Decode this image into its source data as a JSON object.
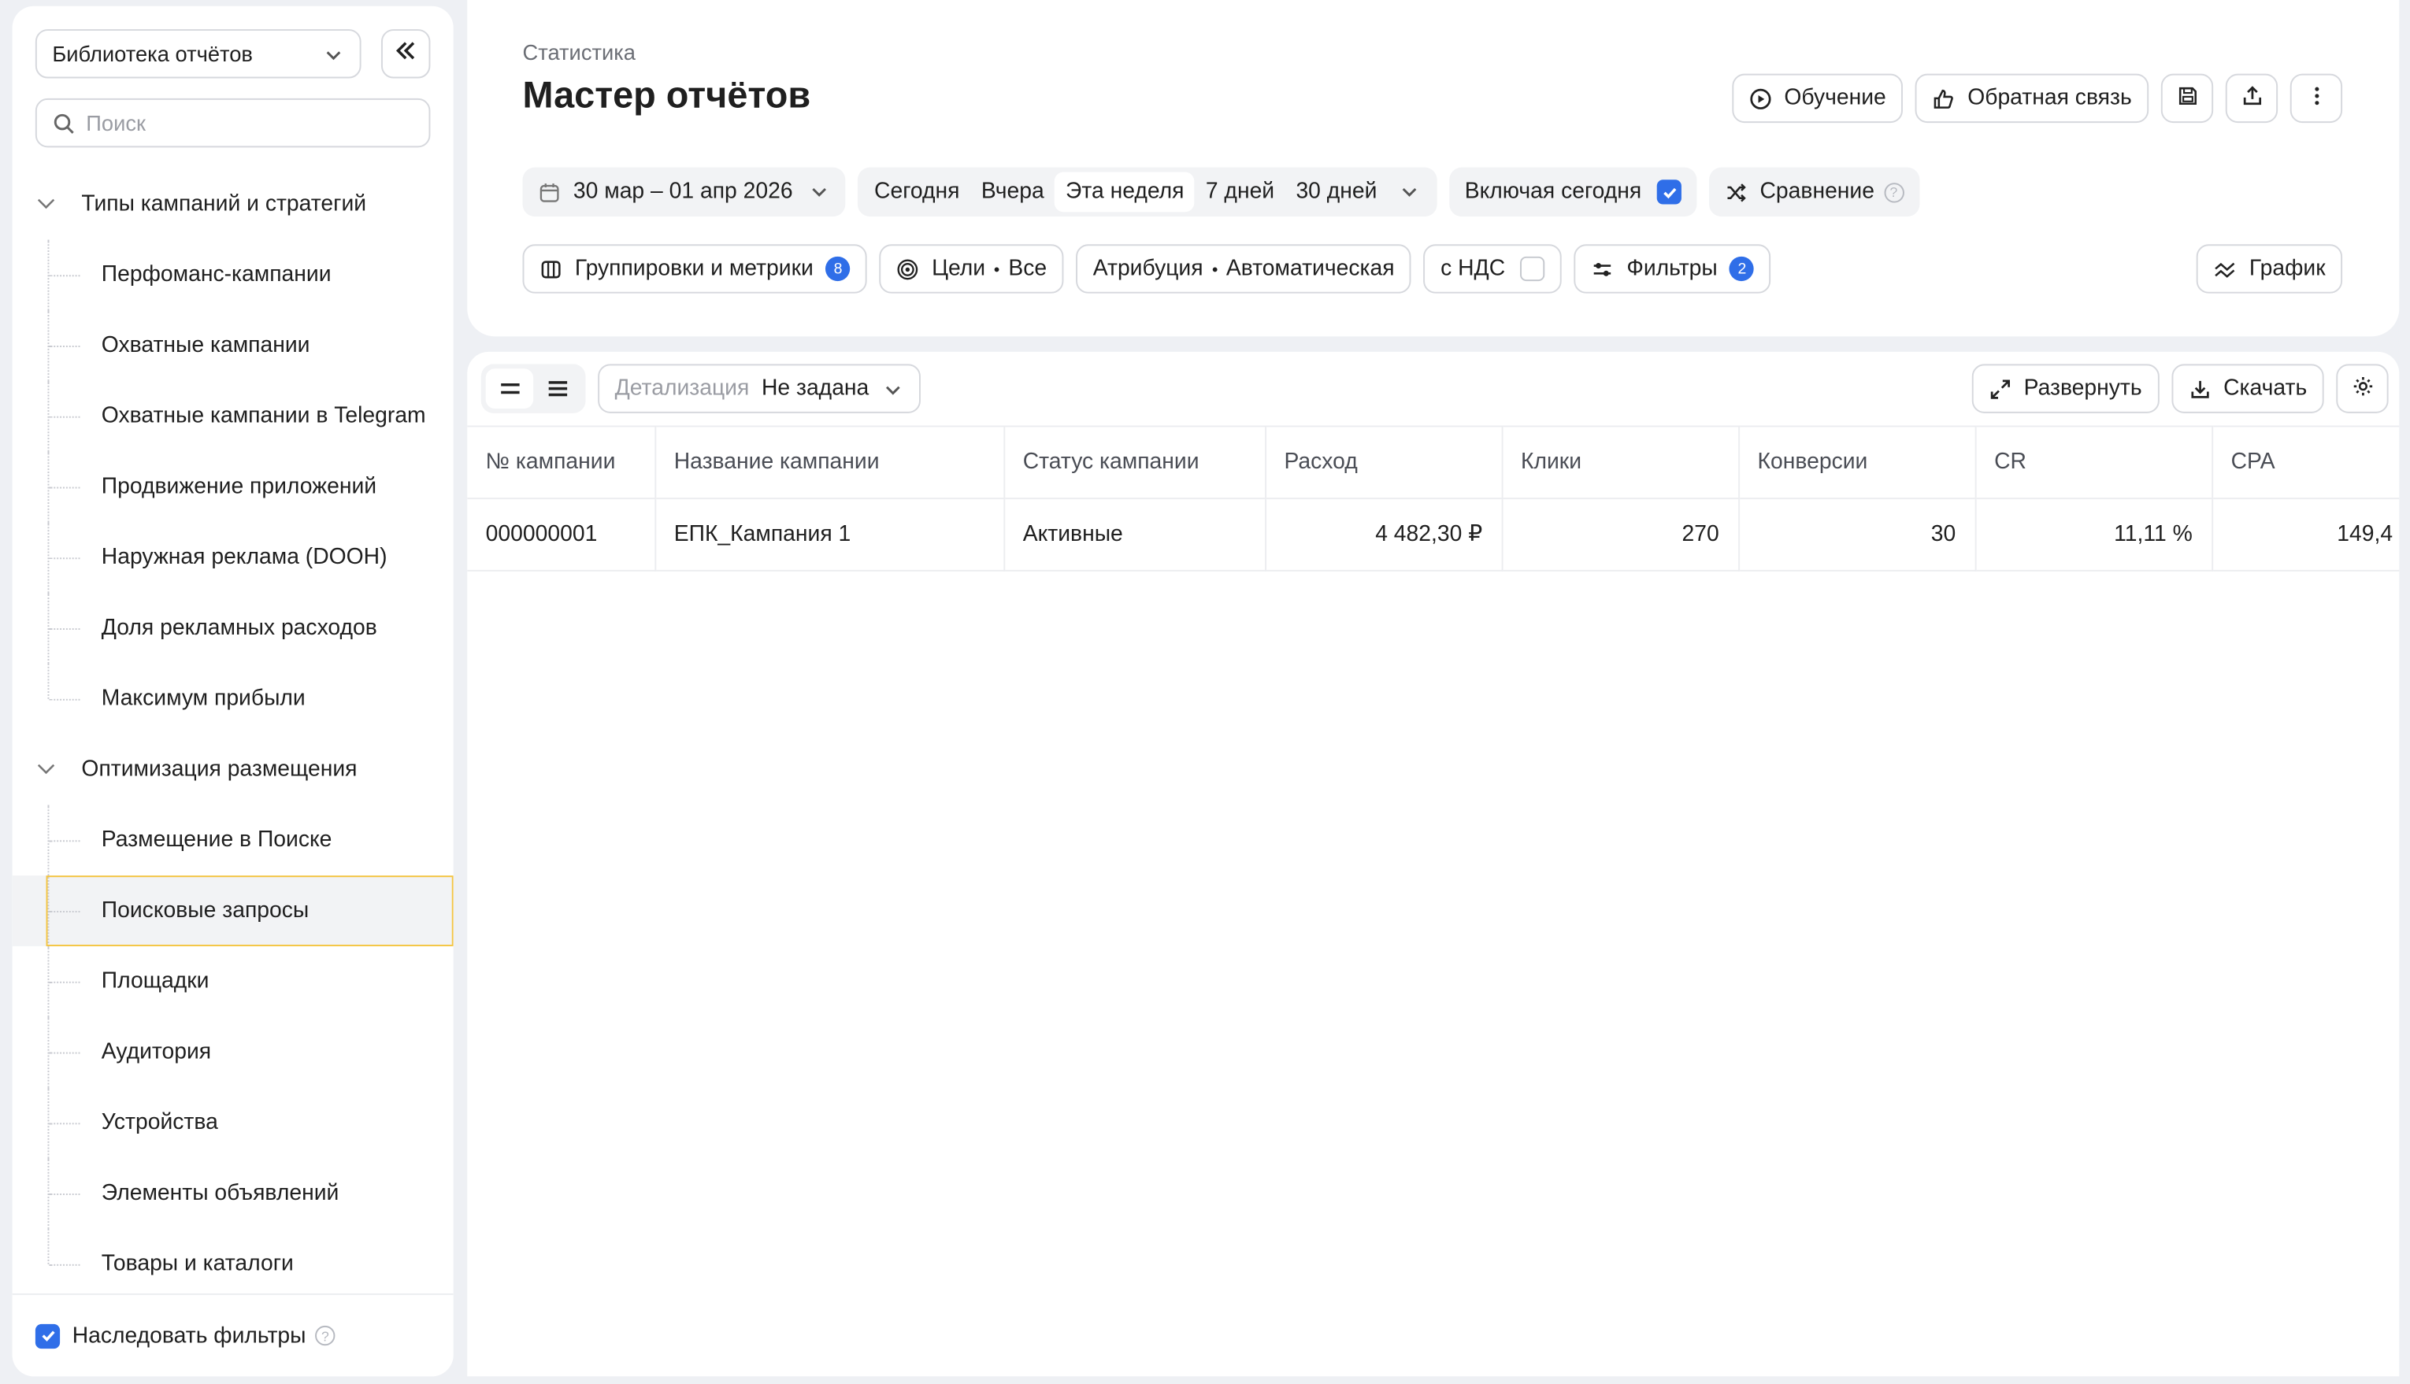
{
  "sidebar": {
    "library_select": "Библиотека отчётов",
    "search_placeholder": "Поиск",
    "groups": [
      {
        "title": "Типы кампаний и стратегий",
        "items": [
          "Перфоманс-кампании",
          "Охватные кампании",
          "Охватные кампании в Telegram",
          "Продвижение приложений",
          "Наружная реклама (DOOH)",
          "Доля рекламных расходов",
          "Максимум прибыли"
        ]
      },
      {
        "title": "Оптимизация размещения",
        "items": [
          "Размещение в Поиске",
          "Поисковые запросы",
          "Площадки",
          "Аудитория",
          "Устройства",
          "Элементы объявлений",
          "Товары и каталоги"
        ]
      }
    ],
    "selected_item": "Поисковые запросы",
    "inherit_filters_label": "Наследовать фильтры",
    "inherit_filters_checked": true
  },
  "header": {
    "breadcrumb": "Статистика",
    "title": "Мастер отчётов",
    "learning_label": "Обучение",
    "feedback_label": "Обратная связь"
  },
  "period": {
    "range": "30 мар – 01 апр 2026",
    "presets": [
      "Сегодня",
      "Вчера",
      "Эта неделя",
      "7 дней",
      "30 дней"
    ],
    "active_preset": "Эта неделя",
    "include_today_label": "Включая сегодня",
    "include_today_checked": true,
    "compare_label": "Сравнение"
  },
  "settings": {
    "groupings_label": "Группировки и метрики",
    "groupings_count": "8",
    "goals_label": "Цели",
    "goals_value": "Все",
    "attribution_label": "Атрибуция",
    "attribution_value": "Автоматическая",
    "vat_label": "с НДС",
    "vat_checked": false,
    "filters_label": "Фильтры",
    "filters_count": "2",
    "graph_label": "График"
  },
  "report": {
    "detail_label": "Детализация",
    "detail_value": "Не задана",
    "expand_label": "Развернуть",
    "download_label": "Скачать",
    "columns": [
      "№ кампании",
      "Название кампании",
      "Статус кампании",
      "Расход",
      "Клики",
      "Конверсии",
      "CR",
      "CPA"
    ],
    "rows": [
      [
        "000000001",
        "ЕПК_Кампания 1",
        "Активные",
        "4 482,30 ₽",
        "270",
        "30",
        "11,11 %",
        "149,4"
      ]
    ]
  },
  "colors": {
    "accent": "#2f6ee8",
    "selection": "#f4c542",
    "background": "#eef0f4"
  }
}
